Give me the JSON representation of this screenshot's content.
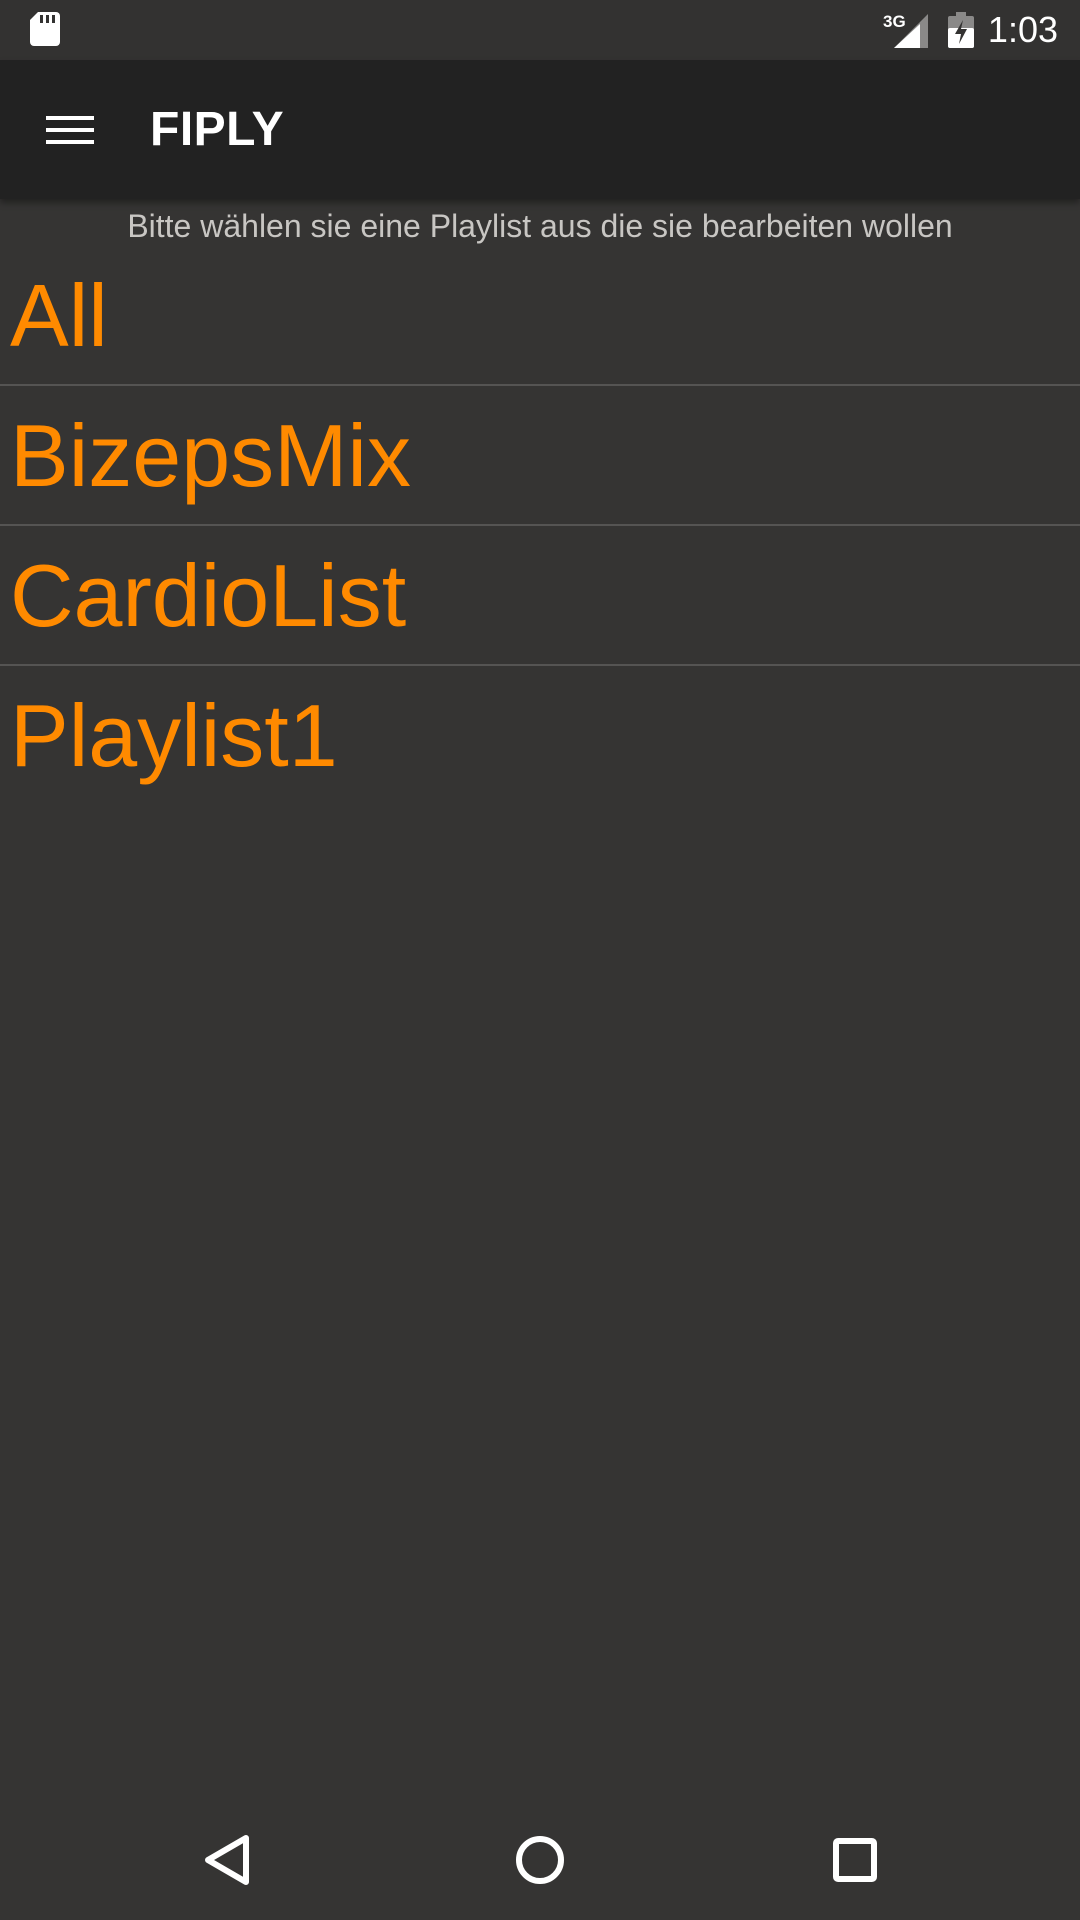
{
  "status_bar": {
    "network_type": "3G",
    "time": "1:03",
    "icons": [
      "sd-card-icon",
      "cell-signal-icon",
      "battery-charging-icon"
    ]
  },
  "app_bar": {
    "title": "FIPLY",
    "menu_icon": "hamburger-menu-icon"
  },
  "main": {
    "instruction": "Bitte wählen sie eine Playlist aus die sie bearbeiten wollen",
    "playlists": [
      {
        "label": "All"
      },
      {
        "label": "BizepsMix"
      },
      {
        "label": "CardioList"
      },
      {
        "label": "Playlist1"
      }
    ]
  },
  "nav_bar": {
    "icons": [
      "back-icon",
      "home-icon",
      "recent-apps-icon"
    ]
  },
  "colors": {
    "accent": "#ff8a00",
    "background": "#353433",
    "app_bar": "#222222",
    "divider": "#555453"
  }
}
